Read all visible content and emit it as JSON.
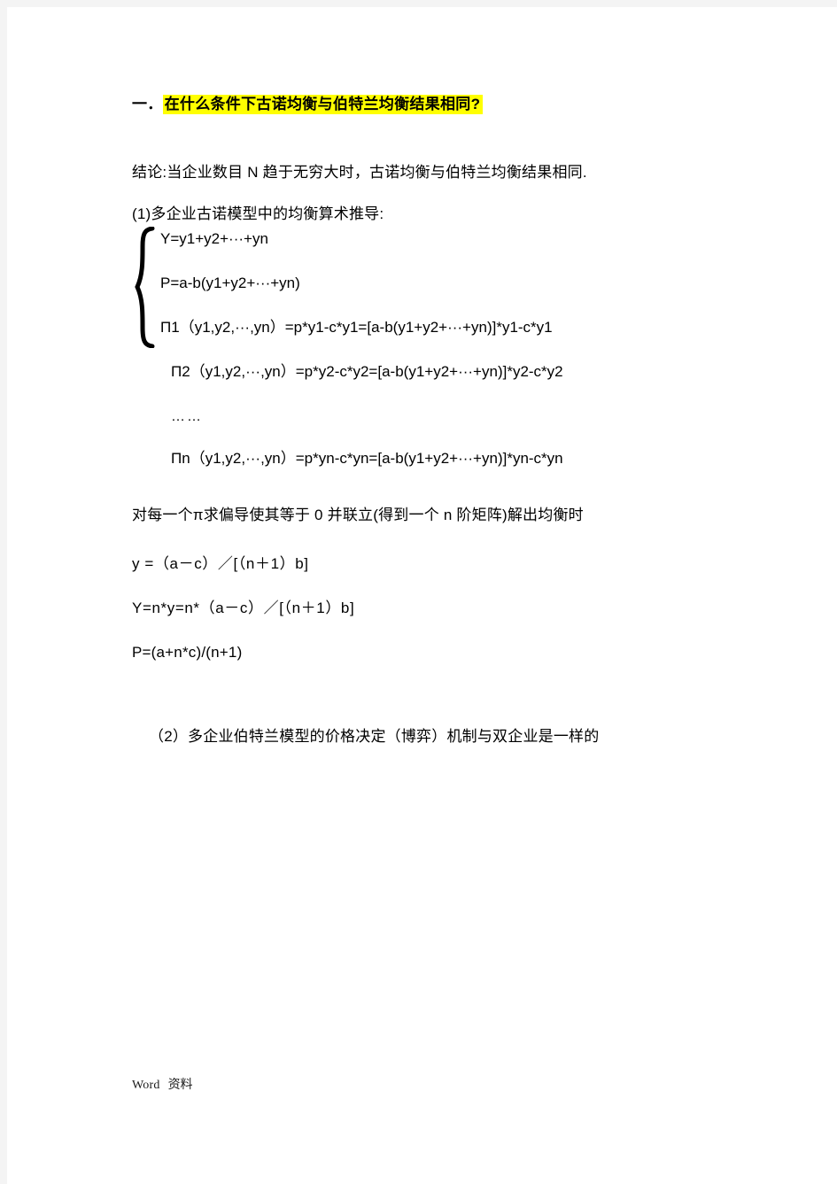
{
  "page": {
    "background_color": "#ffffff",
    "surround_color": "#f4f4f4",
    "highlight_color": "#ffff00",
    "text_color": "#000000"
  },
  "document": {
    "title": {
      "numeral": "一．",
      "text": "在什么条件下古诺均衡与伯特兰均衡结果相同?"
    },
    "conclusion": "结论:当企业数目 N 趋于无穷大时，古诺均衡与伯特兰均衡结果相同.",
    "section_1_heading": "(1)多企业古诺模型中的均衡算术推导:",
    "equation_system": {
      "brace": "left-curly-brace",
      "lines": [
        "Y=y1+y2+···+yn",
        "P=a-b(y1+y2+···+yn)",
        "Π1（y1,y2,···,yn）=p*y1-c*y1=[a-b(y1+y2+···+yn)]*y1-c*y1",
        "Π2（y1,y2,···,yn）=p*y2-c*y2=[a-b(y1+y2+···+yn)]*y2-c*y2",
        "……",
        "Πn（y1,y2,···,yn）=p*yn-c*yn=[a-b(y1+y2+···+yn)]*yn-c*yn"
      ]
    },
    "derivation_note": "对每一个π求偏导使其等于 0 并联立(得到一个 n 阶矩阵)解出均衡时",
    "results": {
      "y": "y =（a－c）／[（n＋1）b]",
      "Y": "Y=n*y=n*（a－c）／[（n＋1）b]",
      "P": "P=(a+n*c)/(n+1)"
    },
    "section_2_heading": "（2）多企业伯特兰模型的价格决定（博弈）机制与双企业是一样的"
  },
  "footer": {
    "word_label": "Word",
    "cn_label": "资料"
  }
}
